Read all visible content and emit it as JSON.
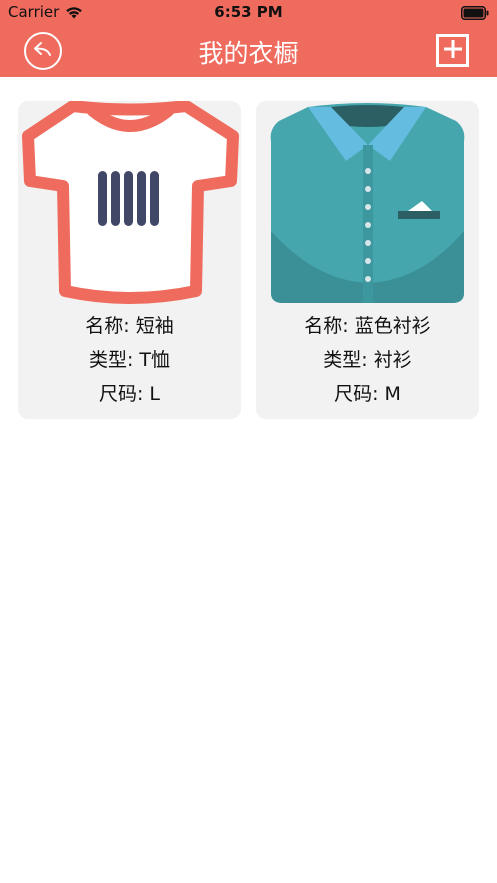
{
  "status_bar": {
    "carrier": "Carrier",
    "time": "6:53 PM",
    "wifi_icon": "wifi-icon",
    "battery_icon": "battery-icon"
  },
  "navbar": {
    "title": "我的衣橱",
    "back_icon": "reply-arrow-icon",
    "add_icon": "plus-square-icon"
  },
  "colors": {
    "header": "#EE6B5E",
    "card": "#F2F2F2"
  },
  "items": [
    {
      "image_icon": "tshirt-icon",
      "name_line": "名称: 短袖",
      "type_line": "类型: T恤",
      "size_line": "尺码: L"
    },
    {
      "image_icon": "blue-shirt-icon",
      "name_line": "名称: 蓝色衬衫",
      "type_line": "类型: 衬衫",
      "size_line": "尺码: M"
    }
  ]
}
